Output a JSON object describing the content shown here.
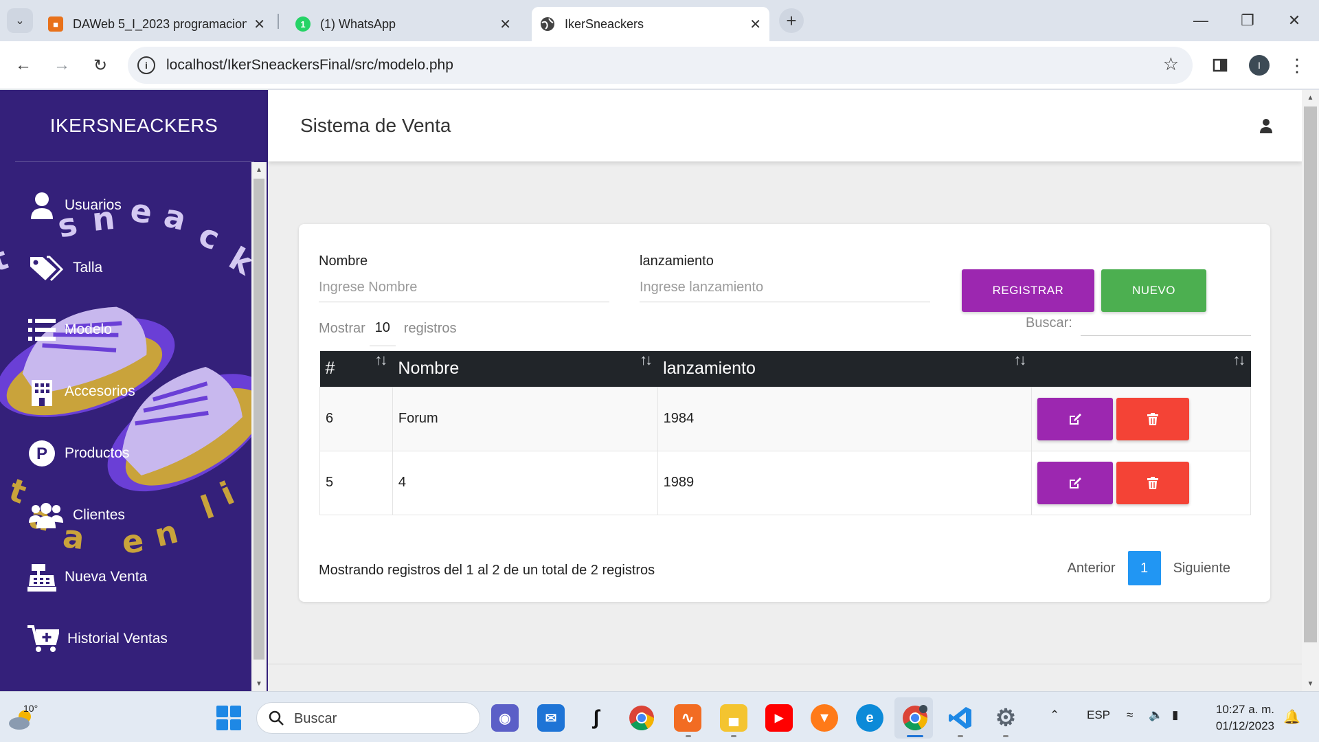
{
  "browser": {
    "tabs": [
      {
        "title": "DAWeb 5_I_2023 programacion",
        "favicon_color": "#e8711a",
        "active": false
      },
      {
        "title": "(1) WhatsApp",
        "favicon_color": "#25d366",
        "badge": "1",
        "active": false
      },
      {
        "title": "IkerSneackers",
        "favicon_color": "#444444",
        "active": true
      }
    ],
    "url": "localhost/IkerSneackersFinal/src/modelo.php",
    "profile_initial": "I"
  },
  "sidebar": {
    "brand": "IKERSNEACKERS",
    "items": [
      {
        "label": "Usuarios",
        "icon": "user-icon"
      },
      {
        "label": "Talla",
        "icon": "tags-icon"
      },
      {
        "label": "Modelo",
        "icon": "list-icon"
      },
      {
        "label": "Accesorios",
        "icon": "building-icon"
      },
      {
        "label": "Productos",
        "icon": "product-p-icon"
      },
      {
        "label": "Clientes",
        "icon": "users-icon"
      },
      {
        "label": "Nueva Venta",
        "icon": "cash-register-icon"
      },
      {
        "label": "Historial Ventas",
        "icon": "cart-plus-icon"
      }
    ],
    "background_colors": {
      "base": "#34207a",
      "shoe_gold": "#c9a33b",
      "shoe_lilac": "#c8b8ee",
      "shoe_purple": "#6a3fd6"
    }
  },
  "header": {
    "title": "Sistema de Venta"
  },
  "form": {
    "nombre_label": "Nombre",
    "nombre_placeholder": "Ingrese Nombre",
    "lanzamiento_label": "lanzamiento",
    "lanzamiento_placeholder": "Ingrese lanzamiento",
    "registrar_label": "REGISTRAR",
    "nuevo_label": "NUEVO"
  },
  "datatable": {
    "show_prefix": "Mostrar",
    "show_value": "10",
    "show_suffix": "registros",
    "search_label": "Buscar:",
    "columns": [
      "#",
      "Nombre",
      "lanzamiento",
      ""
    ],
    "rows": [
      {
        "id": "6",
        "nombre": "Forum",
        "lanzamiento": "1984"
      },
      {
        "id": "5",
        "nombre": "4",
        "lanzamiento": "1989"
      }
    ],
    "info": "Mostrando registros del 1 al 2 de un total de 2 registros",
    "prev_label": "Anterior",
    "current_page": "1",
    "next_label": "Siguiente"
  },
  "colors": {
    "accent_purple": "#9c27b0",
    "accent_green": "#4caf50",
    "danger_red": "#f44336",
    "page_blue": "#2196f3",
    "table_header": "#212529"
  },
  "taskbar": {
    "weather_temp": "10°",
    "search_label": "Buscar",
    "language": "ESP",
    "time": "10:27 a. m.",
    "date": "01/12/2023"
  }
}
